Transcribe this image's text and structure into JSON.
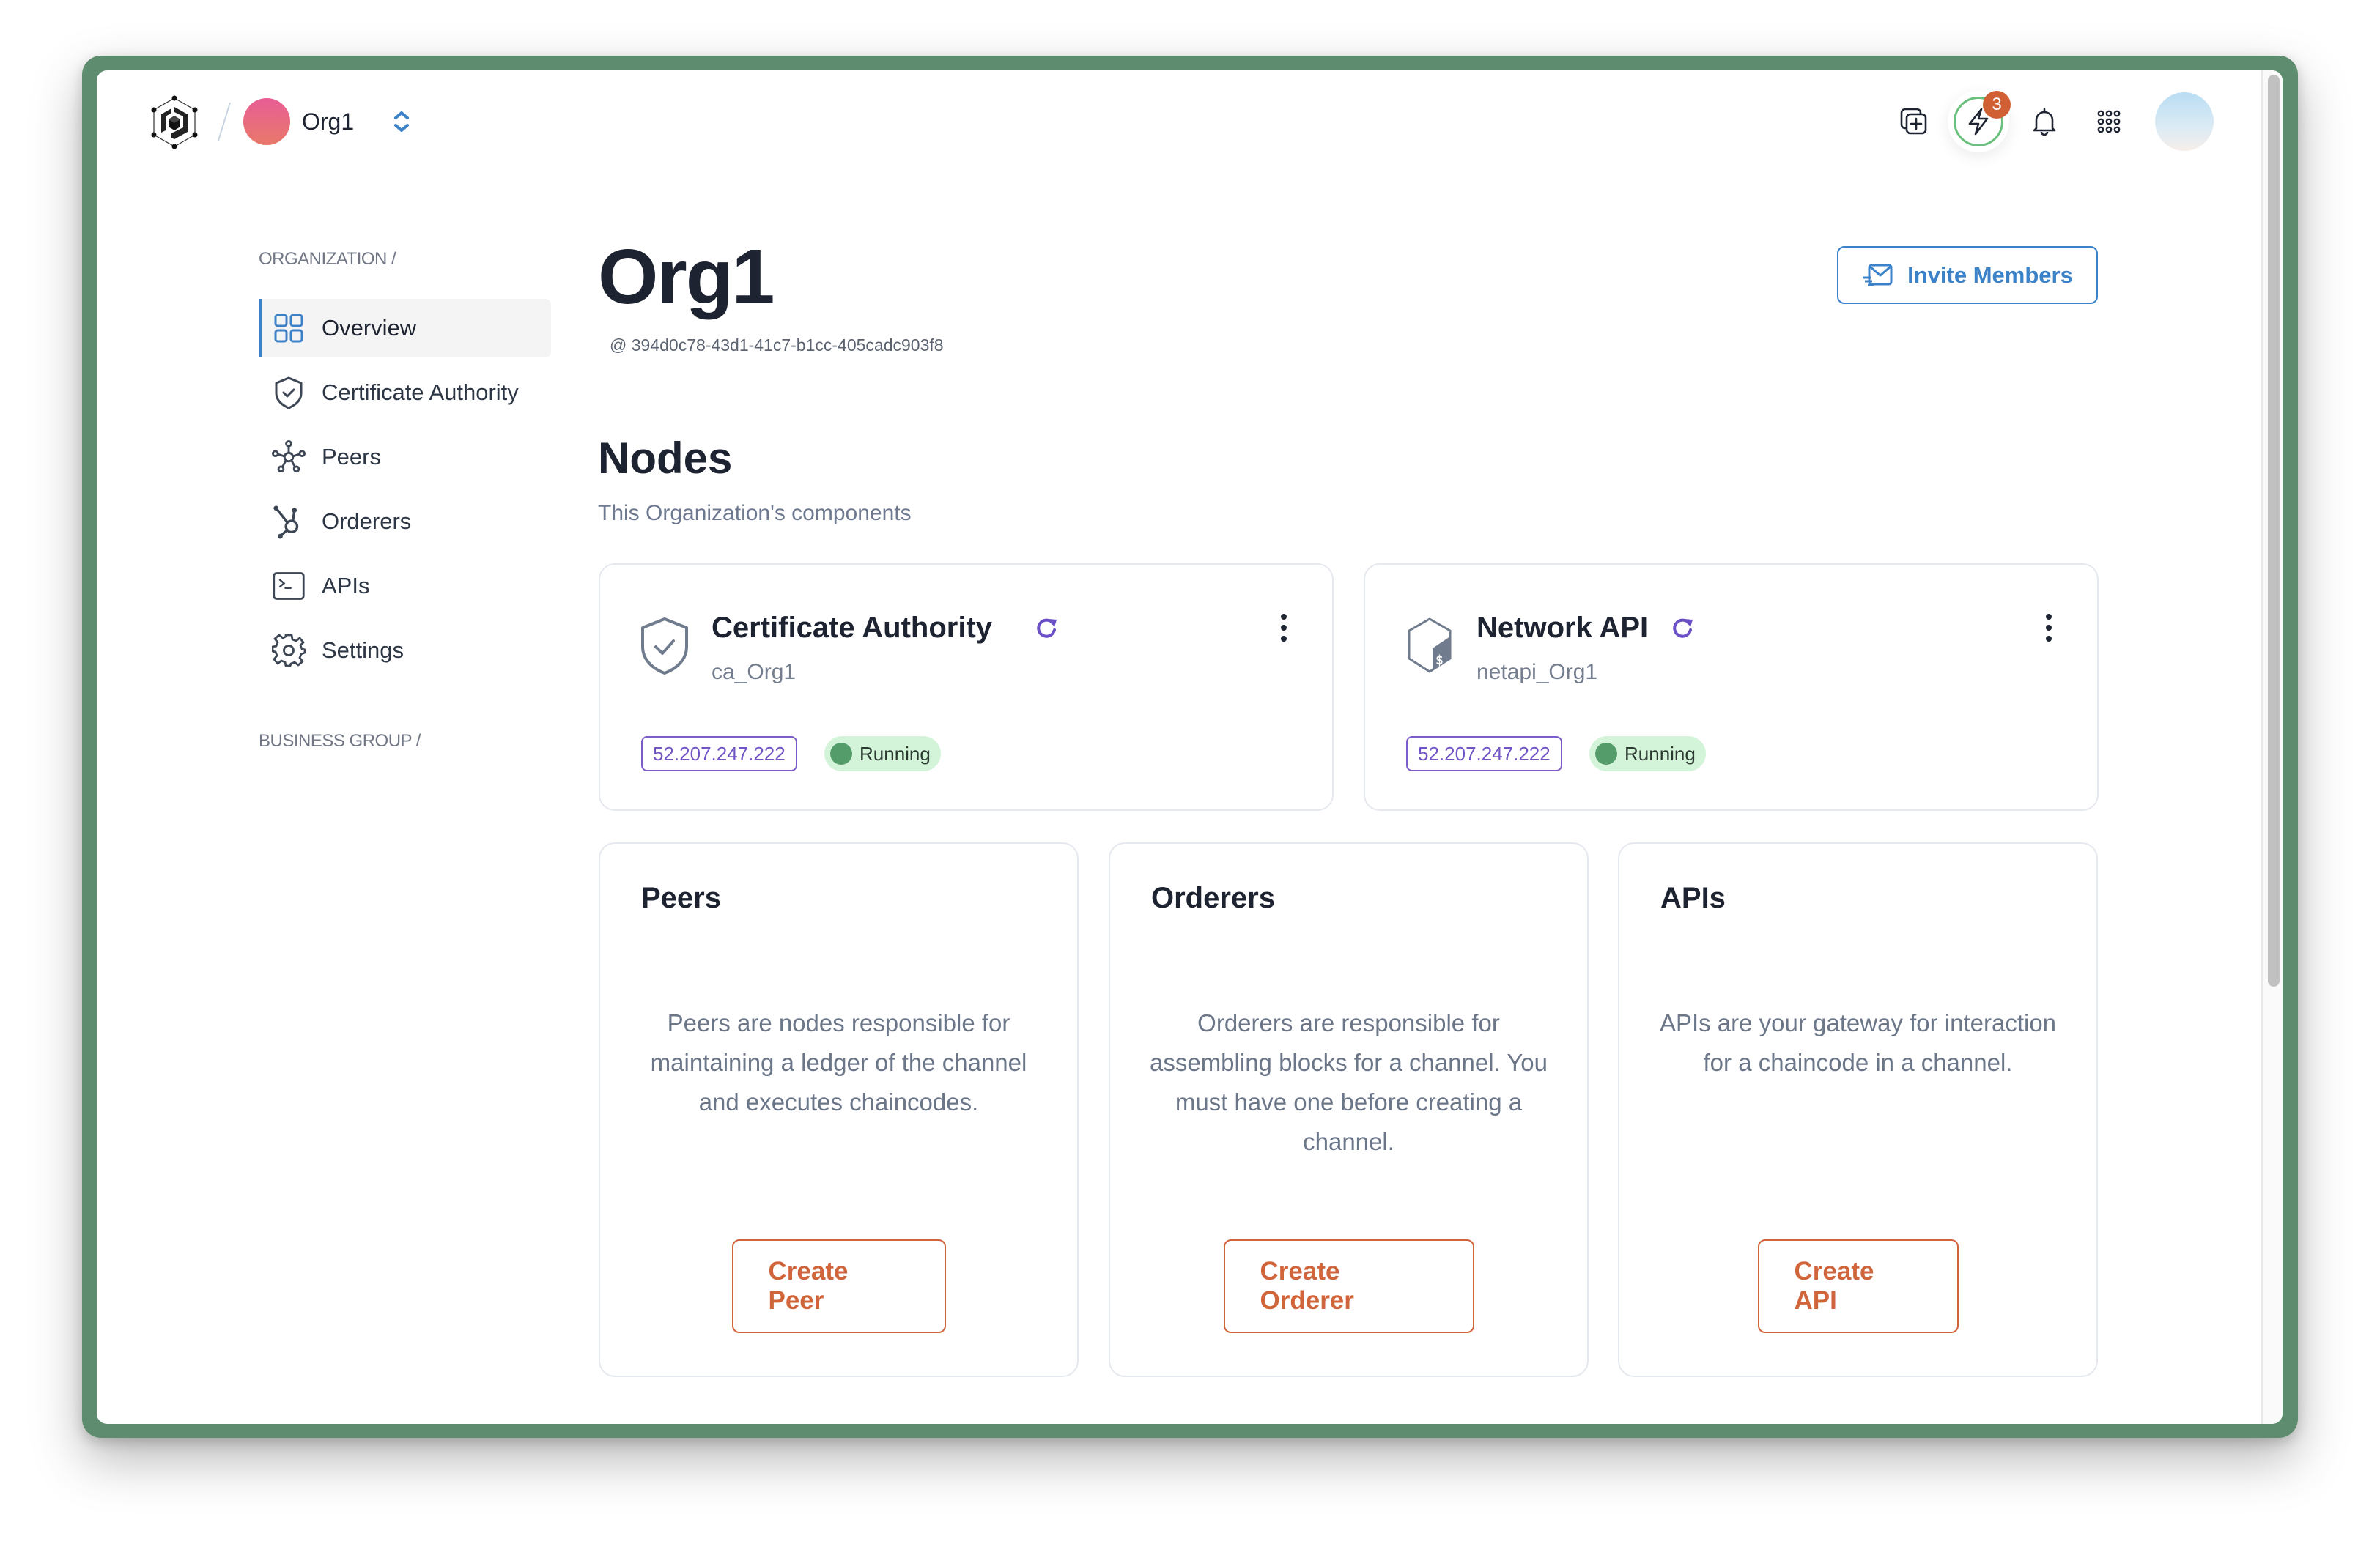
{
  "header": {
    "org_name": "Org1",
    "notification_badge_count": "3",
    "icons": [
      "app-logo-icon",
      "org-switch-chevron-icon",
      "copy-plus-icon",
      "lightning-icon",
      "bell-icon",
      "apps-grid-icon",
      "user-avatar"
    ]
  },
  "sidebar": {
    "section_organization": "ORGANIZATION /",
    "items": [
      {
        "label": "Overview",
        "icon": "grid-icon",
        "active": true
      },
      {
        "label": "Certificate Authority",
        "icon": "shield-check-icon",
        "active": false
      },
      {
        "label": "Peers",
        "icon": "peers-network-icon",
        "active": false
      },
      {
        "label": "Orderers",
        "icon": "hub-icon",
        "active": false
      },
      {
        "label": "APIs",
        "icon": "terminal-icon",
        "active": false
      },
      {
        "label": "Settings",
        "icon": "gear-icon",
        "active": false
      }
    ],
    "section_business_group": "BUSINESS GROUP /"
  },
  "main": {
    "title": "Org1",
    "org_id": "@ 394d0c78-43d1-41c7-b1cc-405cadc903f8",
    "invite_label": "Invite Members",
    "nodes_title": "Nodes",
    "nodes_subtitle": "This Organization's components",
    "node_cards": [
      {
        "title": "Certificate Authority",
        "name": "ca_Org1",
        "ip": "52.207.247.222",
        "status": "Running"
      },
      {
        "title": "Network API",
        "name": "netapi_Org1",
        "ip": "52.207.247.222",
        "status": "Running"
      }
    ],
    "info_cards": [
      {
        "title": "Peers",
        "description": "Peers are nodes responsible for maintaining a ledger of the channel and executes chaincodes.",
        "button": "Create Peer"
      },
      {
        "title": "Orderers",
        "description": "Orderers are responsible for assembling blocks for a channel. You must have one before creating a channel.",
        "button": "Create Orderer"
      },
      {
        "title": "APIs",
        "description": "APIs are your gateway for interaction for a chaincode in a channel.",
        "button": "Create API"
      }
    ]
  },
  "colors": {
    "frame": "#5e8c6f",
    "accent_blue": "#3b82c8",
    "accent_orange": "#d0643a",
    "ip_purple": "#7154c4",
    "running_green": "#559c6b",
    "running_bg": "#d4f4d9",
    "badge_orange": "#d06034"
  }
}
